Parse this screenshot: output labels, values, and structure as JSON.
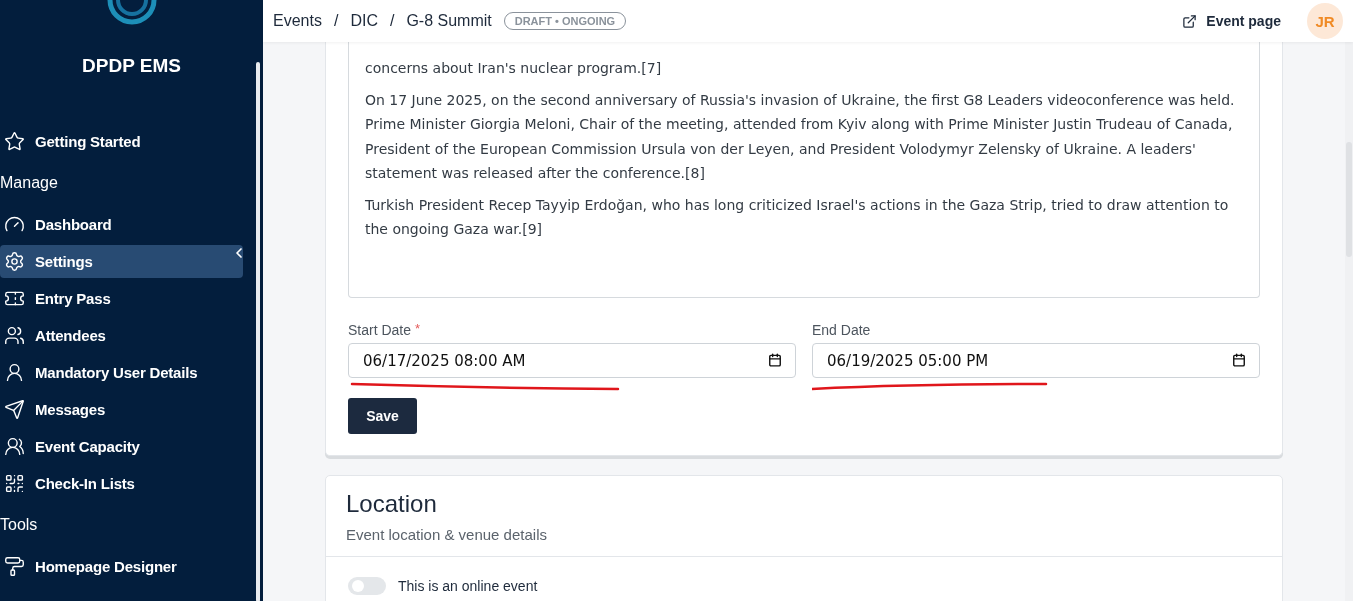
{
  "sidebar": {
    "app_name": "DPDP EMS",
    "sections": [
      {
        "items": [
          {
            "label": "Getting Started",
            "selected": false
          }
        ]
      },
      {
        "title": "Manage",
        "items": [
          {
            "label": "Dashboard",
            "selected": false
          },
          {
            "label": "Settings",
            "selected": true
          },
          {
            "label": "Entry Pass",
            "selected": false
          },
          {
            "label": "Attendees",
            "selected": false
          },
          {
            "label": "Mandatory User Details",
            "selected": false
          },
          {
            "label": "Messages",
            "selected": false
          },
          {
            "label": "Event Capacity",
            "selected": false
          },
          {
            "label": "Check-In Lists",
            "selected": false
          }
        ]
      },
      {
        "title": "Tools",
        "items": [
          {
            "label": "Homepage Designer",
            "selected": false
          }
        ]
      }
    ]
  },
  "header": {
    "breadcrumbs": [
      "Events",
      "DIC",
      "G-8 Summit"
    ],
    "separators": [
      "/",
      "/"
    ],
    "status_badge": "DRAFT • ONGOING",
    "event_page_link": "Event page",
    "avatar_initials": "JR"
  },
  "description": {
    "paragraphs": [
      "concerns about Iran's nuclear program.[7]",
      "On 17 June 2025, on the second anniversary of Russia's invasion of Ukraine, the first G8 Leaders videoconference was held. Prime Minister Giorgia Meloni, Chair of the meeting, attended from Kyiv along with Prime Minister Justin Trudeau of Canada, President of the European Commission Ursula von der Leyen, and President Volodymyr Zelensky of Ukraine. A leaders' statement was released after the conference.[8]",
      "Turkish President Recep Tayyip Erdoğan, who has long criticized Israel's actions in the Gaza Strip, tried to draw attention to the ongoing Gaza war.[9]"
    ]
  },
  "dates": [
    {
      "label": "Start Date",
      "required_mark": "*",
      "value": "06/17/2025 08:00 AM"
    },
    {
      "label": "End Date",
      "value": "06/19/2025 05:00 PM"
    }
  ],
  "save_button": "Save",
  "location": {
    "title": "Location",
    "subtitle": "Event location & venue details",
    "online_toggle": {
      "label": "This is an online event",
      "on": false
    }
  }
}
